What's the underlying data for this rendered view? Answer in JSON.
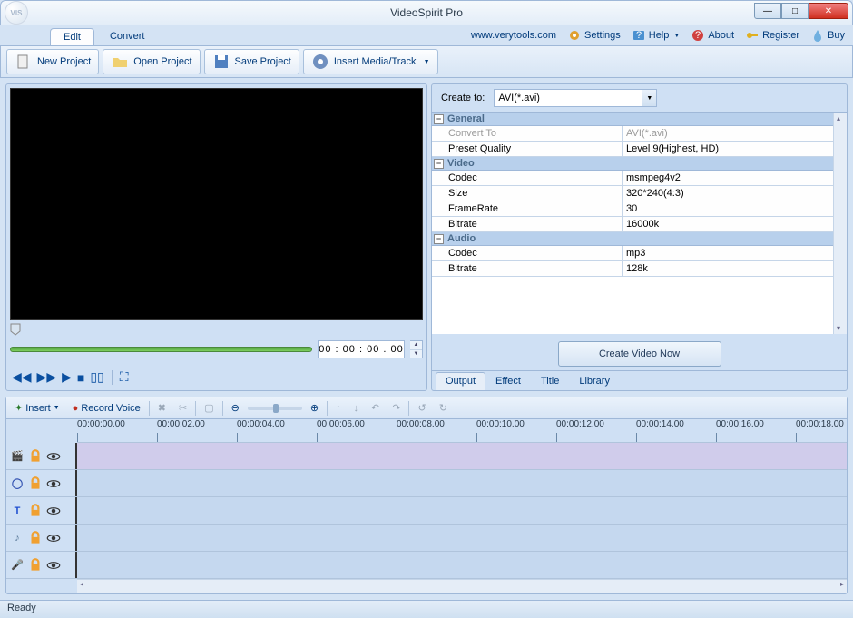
{
  "window": {
    "title": "VideoSpirit Pro",
    "logo_text": "VIS"
  },
  "winbtns": {
    "min": "—",
    "max": "□",
    "close": "✕"
  },
  "ribbontabs": [
    "Edit",
    "Convert"
  ],
  "toplinks": {
    "site": "www.verytools.com",
    "settings": "Settings",
    "help": "Help",
    "about": "About",
    "register": "Register",
    "buy": "Buy"
  },
  "toolbar": {
    "new": "New Project",
    "open": "Open Project",
    "save": "Save Project",
    "insert": "Insert Media/Track"
  },
  "preview": {
    "timecode": "00 : 00 : 00 . 00"
  },
  "controls_glyphs": {
    "rew": "◀◀",
    "ff": "▶▶",
    "play": "▶",
    "stop": "■",
    "pause": "▯▯",
    "full": "⛶"
  },
  "output": {
    "create_to_label": "Create to:",
    "create_to_value": "AVI(*.avi)",
    "create_button": "Create Video Now",
    "groups": [
      {
        "name": "General",
        "rows": [
          {
            "k": "Convert To",
            "v": "AVI(*.avi)",
            "disabled": true
          },
          {
            "k": "Preset Quality",
            "v": "Level 9(Highest, HD)"
          }
        ]
      },
      {
        "name": "Video",
        "rows": [
          {
            "k": "Codec",
            "v": "msmpeg4v2"
          },
          {
            "k": "Size",
            "v": "320*240(4:3)"
          },
          {
            "k": "FrameRate",
            "v": "30"
          },
          {
            "k": "Bitrate",
            "v": "16000k"
          }
        ]
      },
      {
        "name": "Audio",
        "rows": [
          {
            "k": "Codec",
            "v": "mp3"
          },
          {
            "k": "Bitrate",
            "v": "128k"
          }
        ]
      }
    ],
    "tabs": [
      "Output",
      "Effect",
      "Title",
      "Library"
    ]
  },
  "timeline": {
    "insert": "Insert",
    "record": "Record Voice",
    "ruler": [
      "00:00:00.00",
      "00:00:02.00",
      "00:00:04.00",
      "00:00:06.00",
      "00:00:08.00",
      "00:00:10.00",
      "00:00:12.00",
      "00:00:14.00",
      "00:00:16.00",
      "00:00:18.00"
    ],
    "tracks": [
      {
        "type": "video",
        "icon": "clapper",
        "color": "#4a6a9a"
      },
      {
        "type": "overlay",
        "icon": "circle",
        "color": "#3050b0"
      },
      {
        "type": "text",
        "icon": "T",
        "color": "#2050d0"
      },
      {
        "type": "music",
        "icon": "note",
        "color": "#5a7a9a"
      },
      {
        "type": "voice",
        "icon": "mic",
        "color": "#5a7a9a"
      }
    ]
  },
  "status": "Ready"
}
